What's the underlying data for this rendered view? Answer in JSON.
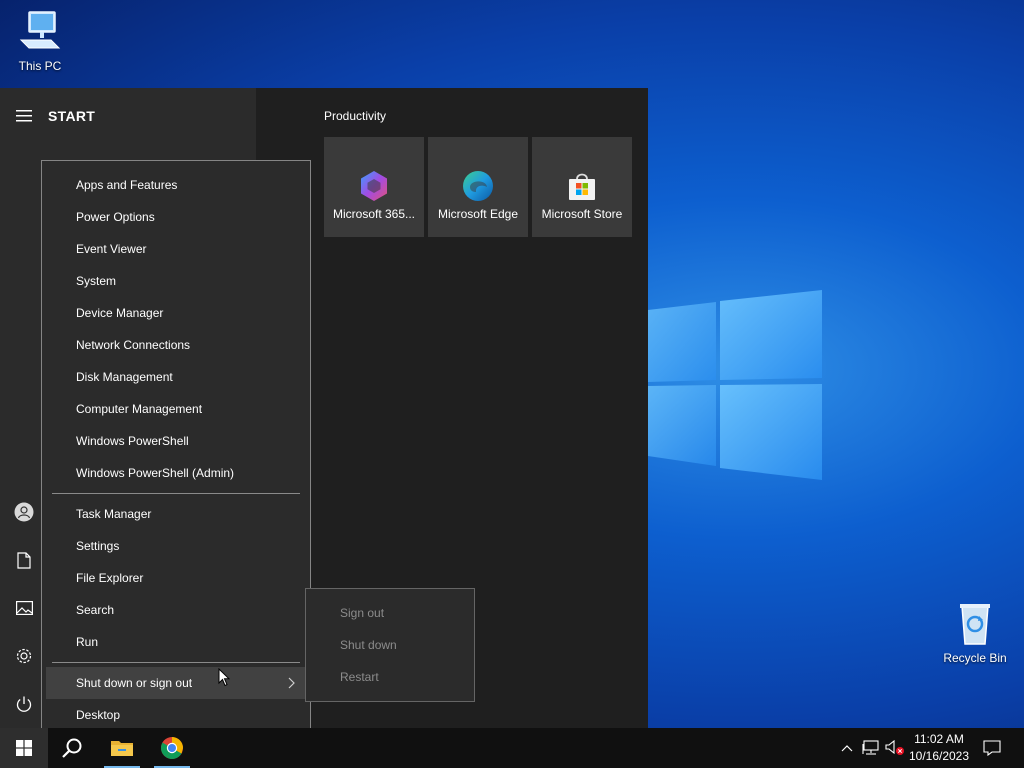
{
  "desktop": {
    "icons": [
      {
        "label": "This PC",
        "icon": "computer-icon"
      },
      {
        "label": "Recycle Bin",
        "icon": "recycle-bin-icon"
      }
    ],
    "accent": "#0a3fa8"
  },
  "start": {
    "title": "START",
    "rail_icons": [
      "user-icon",
      "document-icon",
      "pictures-icon",
      "settings-icon",
      "power-icon"
    ],
    "group_title": "Productivity",
    "tiles": [
      {
        "label": "Microsoft 365...",
        "icon": "microsoft-365-icon"
      },
      {
        "label": "Microsoft Edge",
        "icon": "edge-icon"
      },
      {
        "label": "Microsoft Store",
        "icon": "store-icon"
      }
    ]
  },
  "power_menu": {
    "group1": [
      "Apps and Features",
      "Power Options",
      "Event Viewer",
      "System",
      "Device Manager",
      "Network Connections",
      "Disk Management",
      "Computer Management",
      "Windows PowerShell",
      "Windows PowerShell (Admin)"
    ],
    "group2": [
      "Task Manager",
      "Settings",
      "File Explorer",
      "Search",
      "Run"
    ],
    "group3": [
      "Shut down or sign out",
      "Desktop"
    ],
    "highlighted": "Shut down or sign out"
  },
  "submenu": {
    "items": [
      "Sign out",
      "Shut down",
      "Restart"
    ]
  },
  "taskbar": {
    "buttons": [
      "windows-start-icon",
      "search-icon",
      "file-explorer-icon",
      "chrome-icon"
    ],
    "tray_icons": [
      "chevron-up-icon",
      "network-icon",
      "volume-muted-icon",
      "notifications-icon"
    ],
    "time": "11:02 AM",
    "date": "10/16/2023"
  }
}
